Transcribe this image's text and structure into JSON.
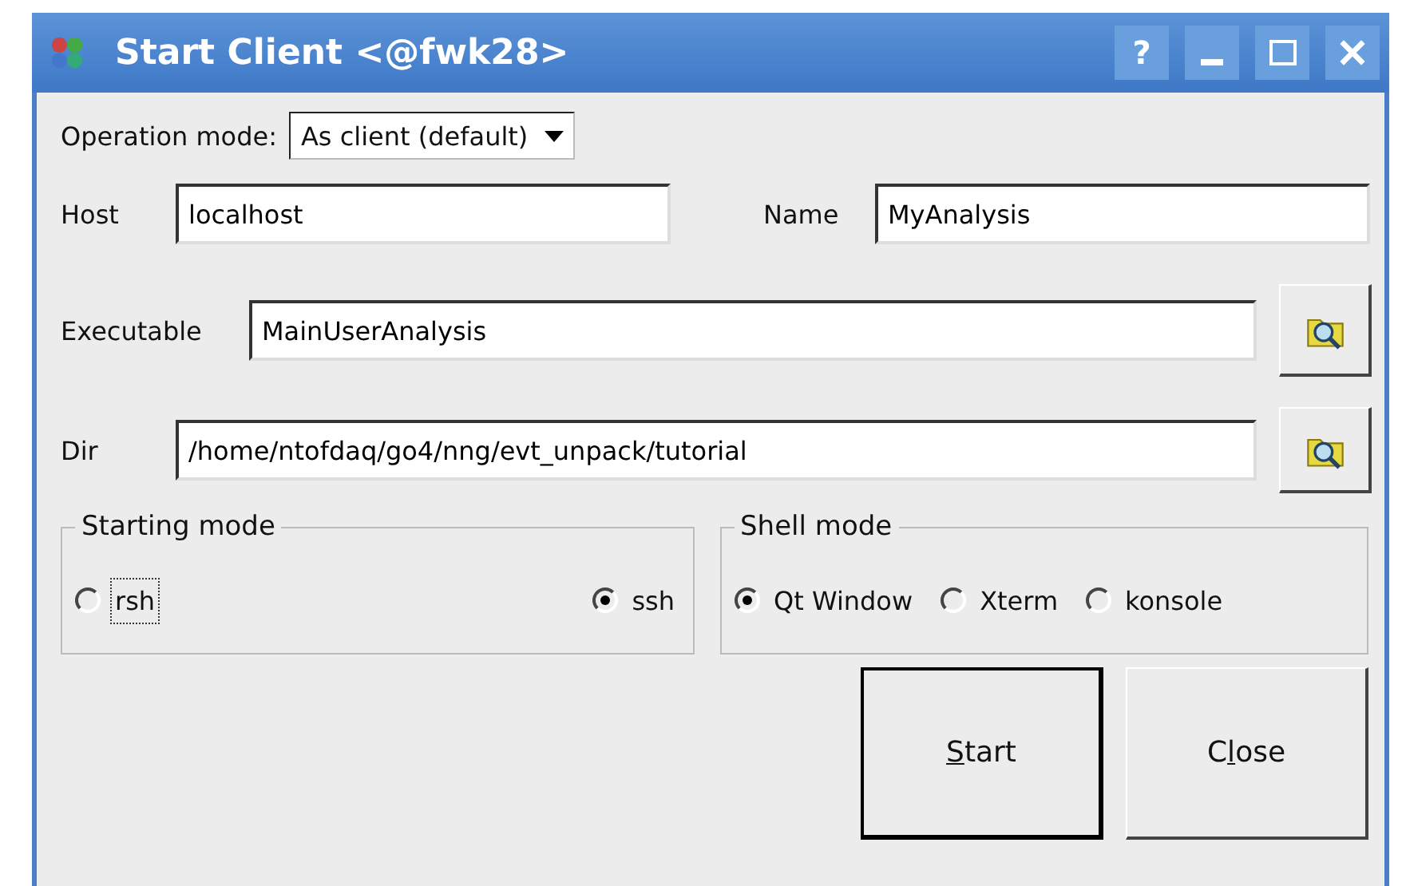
{
  "window": {
    "title": "Start Client <@fwk28>",
    "controls": [
      "?"
    ]
  },
  "operation_mode": {
    "label": "Operation mode:",
    "value": "As client (default)"
  },
  "host": {
    "label": "Host",
    "value": "localhost"
  },
  "name": {
    "label": "Name",
    "value": "MyAnalysis"
  },
  "executable": {
    "label": "Executable",
    "value": "MainUserAnalysis"
  },
  "dir": {
    "label": "Dir",
    "value": "/home/ntofdaq/go4/nng/evt_unpack/tutorial"
  },
  "groups": [
    {
      "title": "Starting mode",
      "options": [
        {
          "label": "rsh",
          "selected": false,
          "focused": true
        },
        {
          "label": "ssh",
          "selected": true,
          "focused": false
        }
      ]
    },
    {
      "title": "Shell mode",
      "options": [
        {
          "label": "Qt Window",
          "selected": true,
          "focused": false
        },
        {
          "label": "Xterm",
          "selected": false,
          "focused": false
        },
        {
          "label": "konsole",
          "selected": false,
          "focused": false
        }
      ]
    }
  ],
  "buttons": [
    {
      "label_parts": [
        {
          "text": "S",
          "underlined": true
        },
        {
          "text": "tart",
          "underlined": false
        }
      ],
      "default": true
    },
    {
      "label_parts": [
        {
          "text": "C",
          "underlined": false
        },
        {
          "text": "l",
          "underlined": true
        },
        {
          "text": "ose",
          "underlined": false
        }
      ],
      "default": false
    }
  ]
}
